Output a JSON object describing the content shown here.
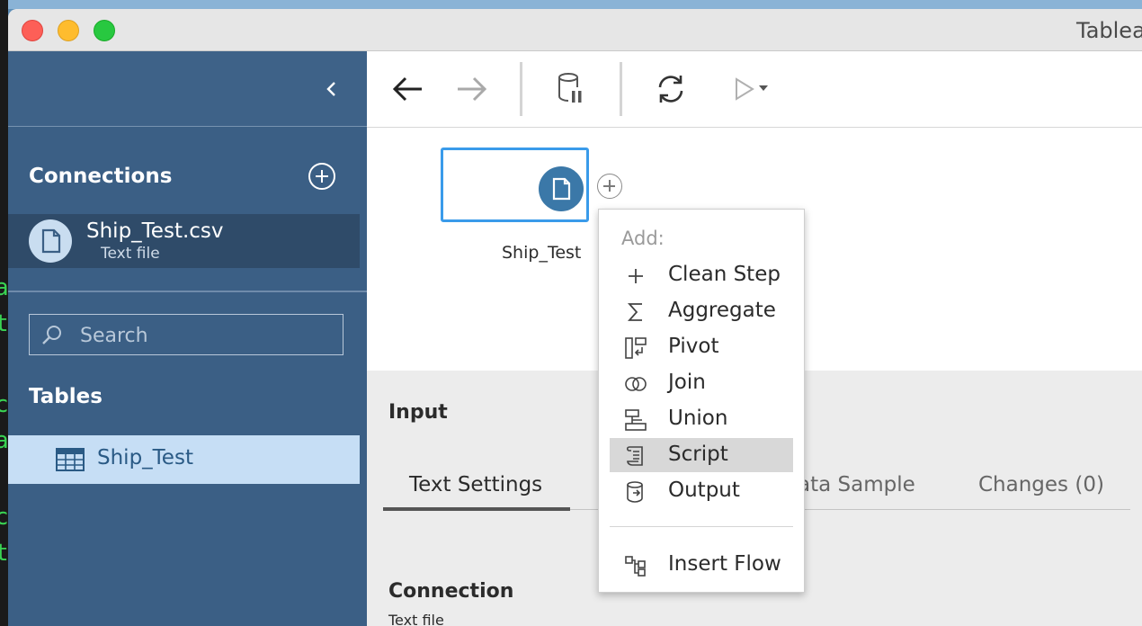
{
  "window": {
    "title": "Tablea"
  },
  "sidebar": {
    "connections_label": "Connections",
    "connection": {
      "name": "Ship_Test.csv",
      "type": "Text file"
    },
    "search": {
      "placeholder": "Search"
    },
    "tables_label": "Tables",
    "tables": [
      {
        "name": "Ship_Test"
      }
    ]
  },
  "canvas": {
    "node": {
      "label": "Ship_Test"
    }
  },
  "add_menu": {
    "header": "Add:",
    "items": [
      {
        "label": "Clean Step",
        "icon": "plus-icon"
      },
      {
        "label": "Aggregate",
        "icon": "sigma-icon"
      },
      {
        "label": "Pivot",
        "icon": "pivot-icon"
      },
      {
        "label": "Join",
        "icon": "join-icon"
      },
      {
        "label": "Union",
        "icon": "union-icon"
      },
      {
        "label": "Script",
        "icon": "script-icon",
        "highlighted": true
      },
      {
        "label": "Output",
        "icon": "output-icon"
      }
    ],
    "insert_flow": {
      "label": "Insert Flow",
      "icon": "insert-flow-icon"
    }
  },
  "bottom_pane": {
    "title": "Input",
    "tabs": [
      {
        "label": "Text Settings",
        "active": true
      },
      {
        "label": "ata Sample"
      },
      {
        "label": "Changes (0)"
      }
    ],
    "connection_title": "Connection",
    "connection_value": "Text file"
  },
  "colors": {
    "sidebar": "#3b5f85",
    "selected_table": "#c6def5",
    "accent": "#3a9bea",
    "node_icon": "#3b78a8"
  }
}
